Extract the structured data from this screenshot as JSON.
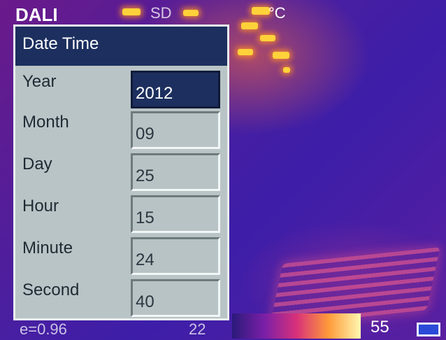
{
  "hud": {
    "brand": "DALI",
    "storage": "SD",
    "unit": "°C"
  },
  "dialog": {
    "title": "Date Time",
    "fields": [
      {
        "label": "Year",
        "value": "2012",
        "selected": true
      },
      {
        "label": "Month",
        "value": "09",
        "selected": false
      },
      {
        "label": "Day",
        "value": "25",
        "selected": false
      },
      {
        "label": "Hour",
        "value": "15",
        "selected": false
      },
      {
        "label": "Minute",
        "value": "24",
        "selected": false
      },
      {
        "label": "Second",
        "value": "40",
        "selected": false
      }
    ]
  },
  "status": {
    "emissivity": "e=0.96",
    "range_low": "22",
    "range_high": "55",
    "battery_icon": "battery-icon"
  },
  "colors": {
    "dialog_title_bg": "#1c2f5e",
    "dialog_bg": "#b9c4c6",
    "selected_field_bg": "#1c2f5e"
  }
}
